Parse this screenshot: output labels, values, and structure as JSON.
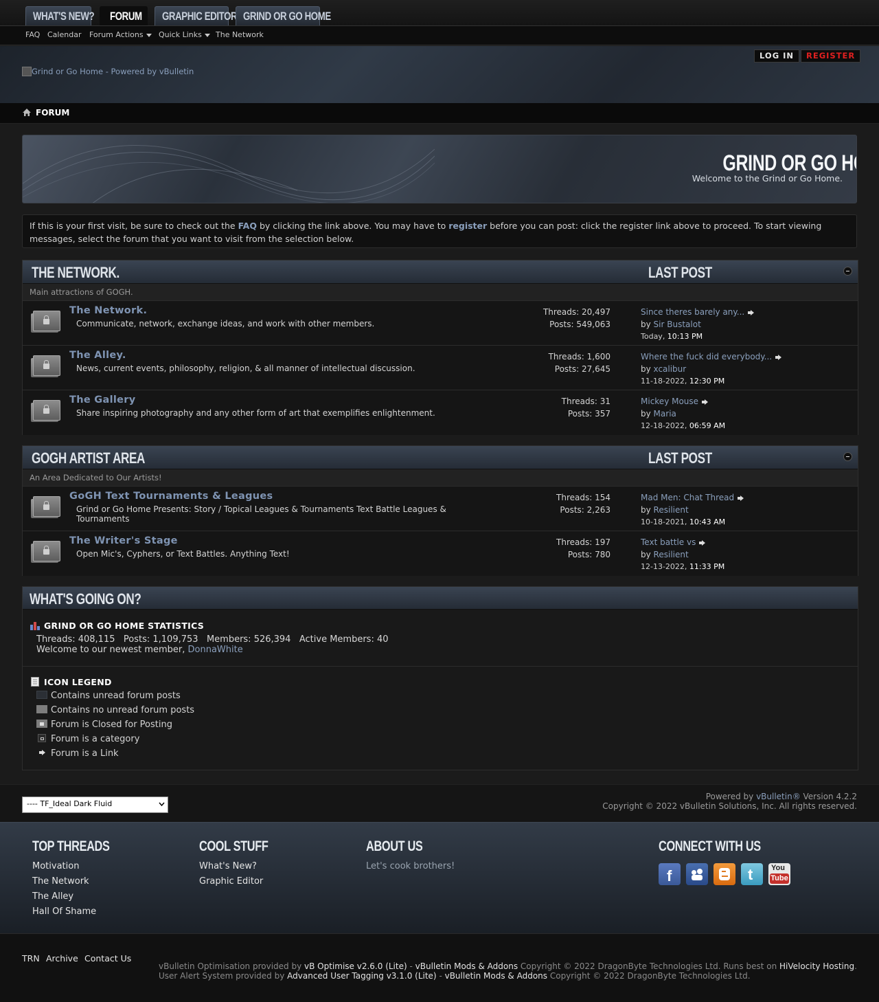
{
  "topnav": {
    "tabs": [
      "WHAT'S NEW?",
      "FORUM",
      "GRAPHIC EDITOR",
      "GRIND OR GO HOME"
    ]
  },
  "subnav": {
    "items": [
      "FAQ",
      "Calendar",
      "Forum Actions",
      "Quick Links",
      "The Network"
    ]
  },
  "header": {
    "logo_alt": "Grind or Go Home - Powered by vBulletin",
    "login": "LOG IN",
    "register": "REGISTER"
  },
  "breadcrumb": {
    "label": "FORUM"
  },
  "banner": {
    "title": "GRIND OR GO HOME",
    "subtitle": "Welcome to the Grind or Go Home."
  },
  "notice": {
    "p1": "If this is your first visit, be sure to check out the ",
    "faq": "FAQ",
    "p2": " by clicking the link above. You may have to ",
    "register": "register",
    "p3": " before you can post: click the register link above to proceed. To start viewing messages, select the forum that you want to visit from the selection below."
  },
  "categories": [
    {
      "title": "THE NETWORK.",
      "lastpost_header": "LAST POST",
      "description": "Main attractions of GOGH.",
      "forums": [
        {
          "title": "The Network.",
          "description": "Communicate, network, exchange ideas, and work with other members.",
          "threads": "Threads: 20,497",
          "posts": "Posts: 549,063",
          "last_title": "Since theres barely any...",
          "by": "by ",
          "last_user": "Sir Bustalot",
          "last_date": "Today,",
          "last_time": " 10:13 PM"
        },
        {
          "title": "The Alley.",
          "description": "News, current events, philosophy, religion, & all manner of intellectual discussion.",
          "threads": "Threads: 1,600",
          "posts": "Posts: 27,645",
          "last_title": "Where the fuck did everybody...",
          "by": "by ",
          "last_user": "xcalibur",
          "last_date": "11-18-2022,",
          "last_time": " 12:30 PM"
        },
        {
          "title": "The Gallery",
          "description": "Share inspiring photography and any other form of art that exemplifies enlightenment.",
          "threads": "Threads: 31",
          "posts": "Posts: 357",
          "last_title": "Mickey Mouse",
          "by": "by ",
          "last_user": "Maria",
          "last_date": "12-18-2022,",
          "last_time": " 06:59 AM"
        }
      ]
    },
    {
      "title": "GOGH ARTIST AREA",
      "lastpost_header": "LAST POST",
      "description": "An Area Dedicated to Our Artists!",
      "forums": [
        {
          "title": "GoGH Text Tournaments & Leagues",
          "description": "Grind or Go Home Presents: Story / Topical Leagues & Tournaments Text Battle Leagues & Tournaments",
          "threads": "Threads: 154",
          "posts": "Posts: 2,263",
          "last_title": "Mad Men: Chat Thread",
          "by": "by ",
          "last_user": "Resilient",
          "last_date": "10-18-2021,",
          "last_time": " 10:43 AM"
        },
        {
          "title": "The Writer's Stage",
          "description": "Open Mic's, Cyphers, or Text Battles. Anything Text!",
          "threads": "Threads: 197",
          "posts": "Posts: 780",
          "last_title": "Text battle vs",
          "by": "by ",
          "last_user": "Resilient",
          "last_date": "12-13-2022,",
          "last_time": " 11:33 PM"
        }
      ]
    }
  ],
  "whats_going_on": {
    "title": "WHAT'S GOING ON?",
    "stats_title": "GRIND OR GO HOME STATISTICS",
    "stats_line": "Threads: 408,115   Posts: 1,109,753   Members: 526,394   Active Members: 40",
    "welcome": "Welcome to our newest member, ",
    "newest_member": "DonnaWhite",
    "legend_title": "ICON LEGEND",
    "legend": [
      "Contains unread forum posts",
      "Contains no unread forum posts",
      "Forum is Closed for Posting",
      "Forum is a category",
      "Forum is a Link"
    ]
  },
  "footer": {
    "style_select": "---- TF_Ideal Dark Fluid",
    "powered_prefix": "Powered by ",
    "powered_link": "vBulletin®",
    "powered_suffix": " Version 4.2.2",
    "copyright": "Copyright © 2022 vBulletin Solutions, Inc. All rights reserved."
  },
  "dark_footer": {
    "top_threads": {
      "title": "TOP THREADS",
      "links": [
        "Motivation",
        "The Network",
        "The Alley",
        "Hall Of Shame"
      ]
    },
    "cool_stuff": {
      "title": "COOL STUFF",
      "links": [
        "What's New?",
        "Graphic Editor"
      ]
    },
    "about": {
      "title": "ABOUT US",
      "text": "Let's cook brothers!"
    },
    "connect": {
      "title": "CONNECT WITH US",
      "icons": [
        "facebook-icon",
        "myspace-icon",
        "blogger-icon",
        "twitter-icon",
        "youtube-icon"
      ],
      "youtube_text_1": "You",
      "youtube_text_2": "Tube"
    }
  },
  "bottom": {
    "links": [
      "TRN",
      "Archive",
      "Contact Us"
    ],
    "line1_a": "vBulletin Optimisation provided by ",
    "line1_b": "vB Optimise v2.6.0 (Lite)",
    "line1_c": " - ",
    "line1_d": "vBulletin Mods & Addons",
    "line1_e": " Copyright © 2022 DragonByte Technologies Ltd. Runs best on ",
    "line1_f": "HiVelocity Hosting",
    "line1_g": ".",
    "line2_a": "User Alert System provided by ",
    "line2_b": "Advanced User Tagging v3.1.0 (Lite)",
    "line2_c": " - ",
    "line2_d": "vBulletin Mods & Addons",
    "line2_e": " Copyright © 2022 DragonByte Technologies Ltd."
  },
  "colors": {
    "accent_link": "#7f94b3",
    "register_red": "#e02020",
    "background": "#1b1b1b"
  }
}
